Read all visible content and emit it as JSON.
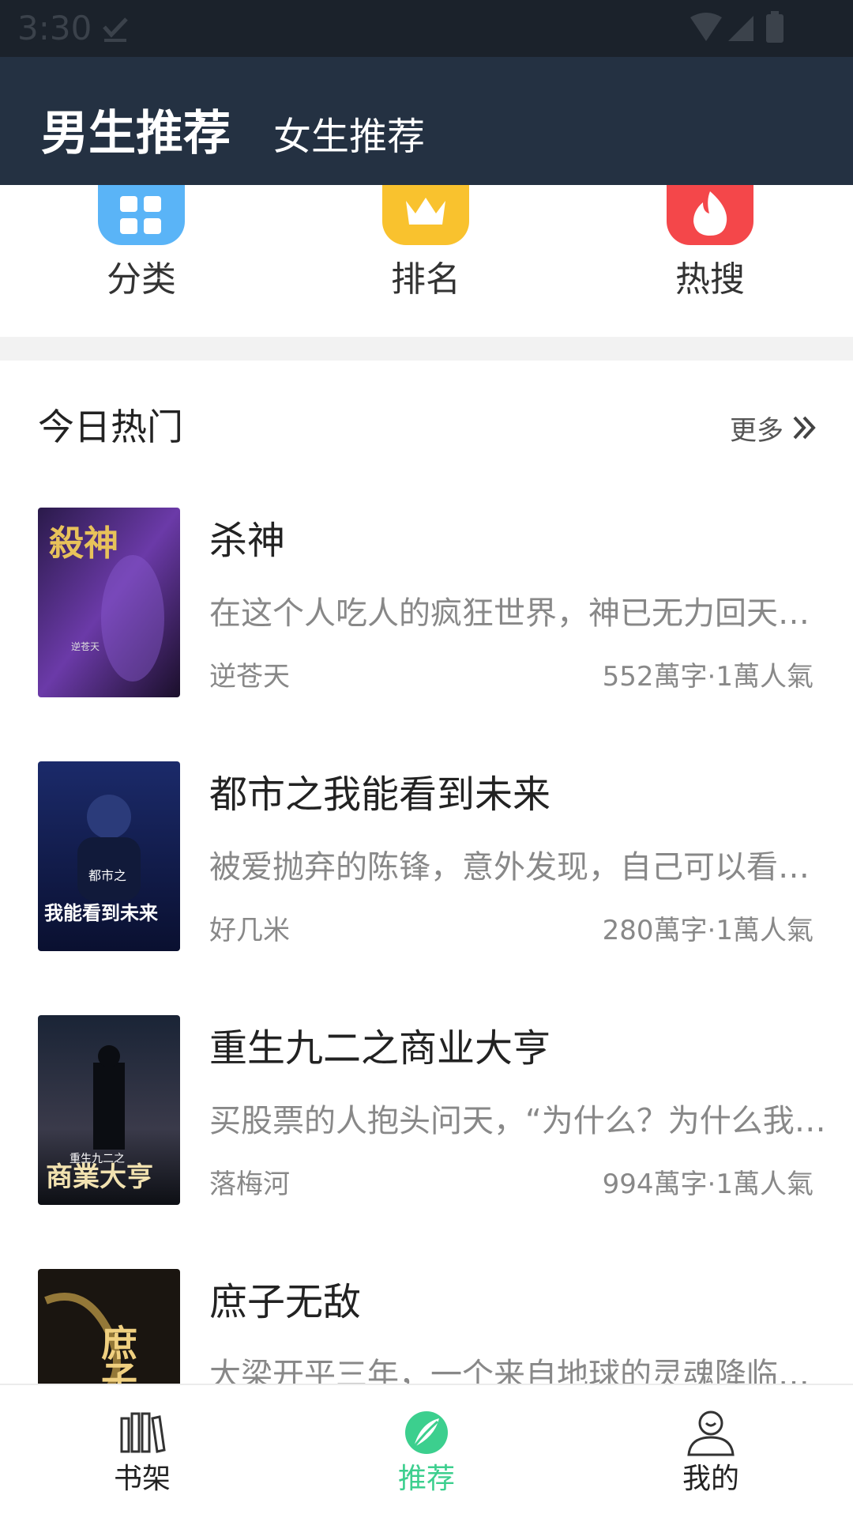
{
  "status_bar": {
    "time": "3:30"
  },
  "header": {
    "tabs": [
      {
        "label": "男生推荐",
        "active": true
      },
      {
        "label": "女生推荐",
        "active": false
      }
    ]
  },
  "quick_nav": [
    {
      "label": "分类",
      "icon": "category-icon",
      "color": "#5ab4f7"
    },
    {
      "label": "排名",
      "icon": "crown-icon",
      "color": "#f9c22e"
    },
    {
      "label": "热搜",
      "icon": "flame-icon",
      "color": "#f4474a"
    }
  ],
  "section": {
    "title": "今日热门",
    "more_label": "更多"
  },
  "books": [
    {
      "title": "杀神",
      "description": "在这个人吃人的疯狂世界，神已无力回天…",
      "author": "逆苍天",
      "meta": "552萬字·1萬人氣",
      "cover_text": "殺神",
      "cover_subtext": "逆苍天"
    },
    {
      "title": "都市之我能看到未来",
      "description": "被爱抛弃的陈锋，意外发现，自己可以看…",
      "author": "好几米",
      "meta": "280萬字·1萬人氣",
      "cover_text": "我能看到未来",
      "cover_subtext": "都市之"
    },
    {
      "title": "重生九二之商业大亨",
      "description": "买股票的人抱头问天，“为什么？为什么我…",
      "author": "落梅河",
      "meta": "994萬字·1萬人氣",
      "cover_text": "商業大亨",
      "cover_subtext": "重生九二之"
    },
    {
      "title": "庶子无敌",
      "description": "大梁开平三年，一个来自地球的灵魂降临…",
      "author": "",
      "meta": "",
      "cover_text": "庶子無敵",
      "cover_subtext": ""
    }
  ],
  "bottom_nav": [
    {
      "label": "书架",
      "icon": "bookshelf-icon",
      "active": false
    },
    {
      "label": "推荐",
      "icon": "recommend-icon",
      "active": true
    },
    {
      "label": "我的",
      "icon": "profile-icon",
      "active": false
    }
  ],
  "colors": {
    "accent": "#3ccf8e",
    "header_bg": "#243142"
  }
}
